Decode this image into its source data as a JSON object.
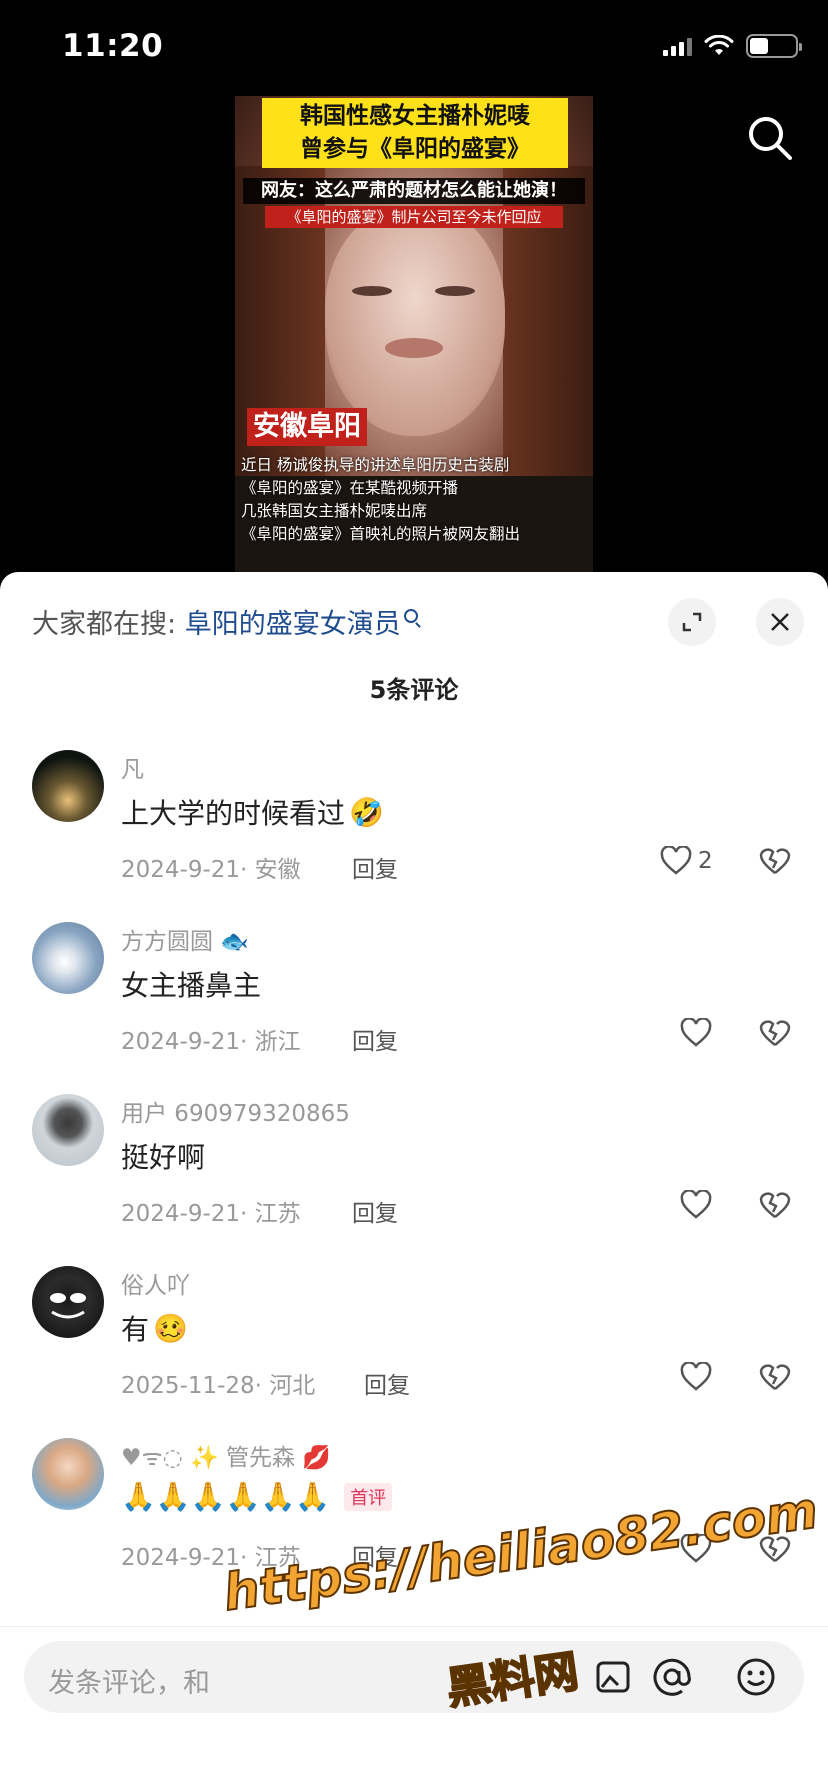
{
  "status_bar": {
    "time": "11:20"
  },
  "video": {
    "title": "韩国性感女主播朴妮唛\n曾参与《阜阳的盛宴》",
    "subtitle_1": "网友：这么严肃的题材怎么能让她演！",
    "subtitle_2": "《阜阳的盛宴》制片公司至今未作回应",
    "location_tag": "安徽阜阳",
    "description": "近日 杨诚俊执导的讲述阜阳历史古装剧\n《阜阳的盛宴》在某酷视频开播\n几张韩国女主播朴妮唛出席\n《阜阳的盛宴》首映礼的照片被网友翻出"
  },
  "sheet": {
    "hot_search_prefix": "大家都在搜:",
    "hot_search_keyword": "阜阳的盛宴女演员",
    "comment_count": "5条评论"
  },
  "comments": [
    {
      "name": "凡",
      "text": "上大学的时候看过",
      "emoji": "🤣",
      "date": "2024-9-21",
      "region": "安徽",
      "reply": "回复",
      "likes": "2"
    },
    {
      "name": "方方圆圆",
      "name_emoji": "🐟",
      "text": "女主播鼻主",
      "date": "2024-9-21",
      "region": "浙江",
      "reply": "回复",
      "likes": ""
    },
    {
      "name": "用户 690979320865",
      "text": "挺好啊",
      "date": "2024-9-21",
      "region": "江苏",
      "reply": "回复",
      "likes": ""
    },
    {
      "name": "俗人吖",
      "text": "有",
      "emoji": "🥴",
      "date": "2025-11-28",
      "region": "河北",
      "reply": "回复",
      "likes": ""
    },
    {
      "name": "♥ᯤ◌ ✨ 管先森",
      "name_emoji": "💋",
      "text": "🙏🙏🙏🙏🙏🙏",
      "badge": "首评",
      "date": "2024-9-21",
      "region": "江苏",
      "reply": "回复",
      "likes": ""
    }
  ],
  "input_bar": {
    "placeholder": "发条评论，和"
  },
  "watermark": {
    "line1": "https://heiliao82.com",
    "line2": "黑料网"
  },
  "colors": {
    "accent_link": "#1f4d8f",
    "badge_bg": "#fde8ec",
    "badge_text": "#e0365a",
    "watermark": "#f3a534"
  }
}
